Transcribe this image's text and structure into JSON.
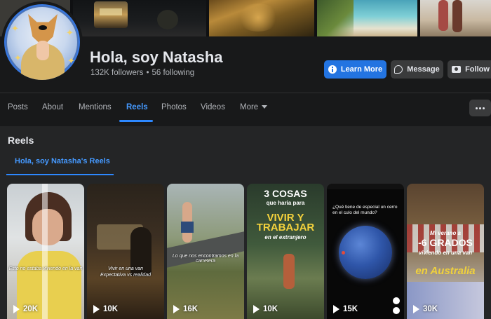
{
  "profile": {
    "name": "Hola, soy Natasha",
    "followers": "132K followers",
    "separator": "•",
    "following": "56 following"
  },
  "actions": {
    "learn_more": "Learn More",
    "message": "Message",
    "follow": "Follow"
  },
  "tabs": [
    {
      "label": "Posts"
    },
    {
      "label": "About"
    },
    {
      "label": "Mentions"
    },
    {
      "label": "Reels"
    },
    {
      "label": "Photos"
    },
    {
      "label": "Videos"
    },
    {
      "label": "More"
    }
  ],
  "active_tab": "Reels",
  "reels_section": {
    "title": "Reels",
    "sub_tab": "Hola, soy Natasha's Reels"
  },
  "reels": [
    {
      "views": "20K",
      "caption": "Esto no estaba viviendo en la van"
    },
    {
      "views": "10K",
      "caption_1": "Vivir en una van",
      "caption_2": "Expectativa vs realidad"
    },
    {
      "views": "16K",
      "caption": "Lo que nos encontramos en la carretera"
    },
    {
      "views": "10K",
      "line1": "3 COSAS",
      "line2": "que haría para",
      "line3": "VIVIR Y TRABAJAR",
      "line4": "en el extranjero"
    },
    {
      "views": "15K",
      "caption": "¿Qué tiene de especial un cerro en el culo del mundo?"
    },
    {
      "views": "30K",
      "line1": "Mi verano a",
      "line2": "-6 GRADOS",
      "line3": "viviendo en una van",
      "line4": "en Australia"
    }
  ],
  "colors": {
    "accent": "#2d88ff",
    "primary_button": "#2374e1",
    "background": "#18191a",
    "panel": "#242526"
  }
}
